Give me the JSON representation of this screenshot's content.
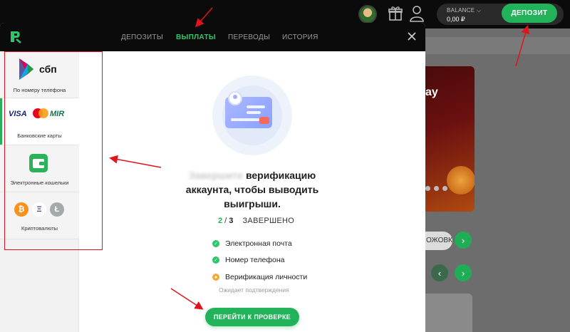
{
  "header": {
    "balance_label": "BALANCE",
    "balance_chevron": "⌵",
    "balance_value": "0,00 ₽",
    "deposit_label": "ДЕПОЗИТ",
    "icons": [
      "avatar",
      "gift-icon",
      "user-icon"
    ]
  },
  "modal": {
    "tabs": [
      {
        "label": "ДЕПОЗИТЫ"
      },
      {
        "label": "ВЫПЛАТЫ",
        "active": true
      },
      {
        "label": "ПЕРЕВОДЫ"
      },
      {
        "label": "ИСТОРИЯ"
      }
    ],
    "close_icon": "close-icon",
    "logo_icon": "brand-logo-icon"
  },
  "sidebar": {
    "items": [
      {
        "brand": "сбп",
        "label": "По номеру телефона"
      },
      {
        "brands": [
          "VISA",
          "MIR"
        ],
        "label": "Банковские карты",
        "selected": true
      },
      {
        "label": "Электронные кошельки"
      },
      {
        "coins": [
          "₿",
          "Ξ",
          "Ł"
        ],
        "label": "Криптовалюты"
      }
    ]
  },
  "content": {
    "headline_blurred": "Завершите",
    "headline_rest": "верификацию аккаунта, чтобы выводить выигрыши.",
    "progress_current": "2",
    "progress_sep": " / ",
    "progress_total": "3",
    "progress_status": "ЗАВЕРШЕНО",
    "steps": [
      {
        "label": "Электронная почта",
        "state": "done"
      },
      {
        "label": "Номер телефона",
        "state": "done"
      },
      {
        "label": "Верификация личности",
        "state": "pending"
      }
    ],
    "pending_note": "Ожидает подтверждения",
    "cta_label": "ПЕРЕЙТИ К ПРОВЕРКЕ"
  },
  "background_site": {
    "banner_text": "ay",
    "search_fragment": "ОЖОВК",
    "arrow_right": "›",
    "arrow_left": "‹"
  },
  "colors": {
    "accent_green": "#22b35a",
    "annotation_red": "#e0141d",
    "header_bg": "#0b0b0b"
  }
}
